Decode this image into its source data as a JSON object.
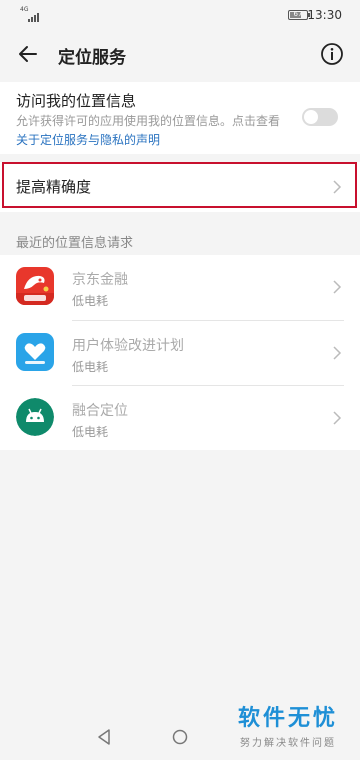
{
  "status_bar": {
    "network": "4G",
    "battery": "67",
    "battery_fraction": 0.67,
    "time": "13:30"
  },
  "header": {
    "title": "定位服务"
  },
  "location_access": {
    "title": "访问我的位置信息",
    "desc_prefix": "允许获得许可的应用使用我的位置信息。点击查看",
    "desc_link": "关于定位服务与隐私的声明",
    "enabled": false
  },
  "accuracy": {
    "label": "提高精确度"
  },
  "recent": {
    "header": "最近的位置信息请求",
    "apps": [
      {
        "name": "京东金融",
        "sub": "低电耗",
        "icon": "jd-finance-icon"
      },
      {
        "name": "用户体验改进计划",
        "sub": "低电耗",
        "icon": "user-experience-icon"
      },
      {
        "name": "融合定位",
        "sub": "低电耗",
        "icon": "android-icon"
      }
    ]
  },
  "watermark": {
    "title": "软件无忧",
    "subtitle": "努力解决软件问题"
  },
  "colors": {
    "highlight": "#c8102e",
    "link": "#2a73c0",
    "watermark": "#1e8fd6"
  }
}
